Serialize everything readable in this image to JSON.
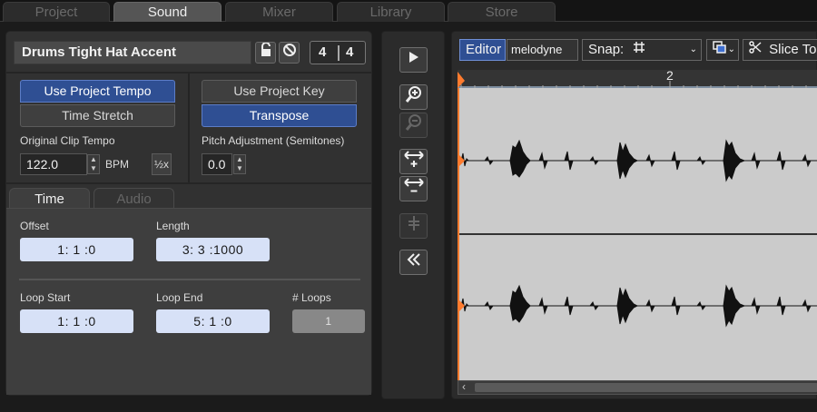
{
  "top_tabs": [
    {
      "label": "Project",
      "active": false
    },
    {
      "label": "Sound",
      "active": true
    },
    {
      "label": "Mixer",
      "active": false
    },
    {
      "label": "Library",
      "active": false
    },
    {
      "label": "Store",
      "active": false
    }
  ],
  "clip": {
    "name": "Drums Tight Hat Accent",
    "time_sig_num": "4",
    "time_sig_den": "4"
  },
  "tempo": {
    "use_project_tempo_label": "Use Project Tempo",
    "time_stretch_label": "Time Stretch",
    "original_clip_tempo_label": "Original Clip Tempo",
    "tempo_value": "122.0",
    "bpm_label": "BPM",
    "half_label": "½x"
  },
  "pitch": {
    "use_project_key_label": "Use Project Key",
    "transpose_label": "Transpose",
    "pitch_adjustment_label": "Pitch Adjustment (Semitones)",
    "pitch_value": "0.0"
  },
  "sub_tabs": [
    {
      "label": "Time",
      "active": true
    },
    {
      "label": "Audio",
      "active": false
    }
  ],
  "time": {
    "offset_label": "Offset",
    "offset_value": "1:   1   :0",
    "length_label": "Length",
    "length_value": "3:   3   :1000",
    "loop_start_label": "Loop Start",
    "loop_start_value": "1:   1   :0",
    "loop_end_label": "Loop End",
    "loop_end_value": "5:   1   :0",
    "loops_label": "# Loops",
    "loops_value": "1"
  },
  "tools": {
    "play": "▶",
    "zoom_in": "+",
    "zoom_out": "−",
    "expand": "+",
    "contract": "−",
    "snap": "‡",
    "collapse": "«"
  },
  "editor": {
    "editor_label": "Editor",
    "melodyne_label": "melodyne",
    "snap_label": "Snap:",
    "snap_grid_icon": "#",
    "slice_label": "Slice To",
    "ruler_marker": "2",
    "scroll_left": "‹"
  },
  "colors": {
    "accent_blue": "#2f4f93",
    "playhead_orange": "#ff7b2e",
    "waveform_bg": "#cbcbcb"
  }
}
